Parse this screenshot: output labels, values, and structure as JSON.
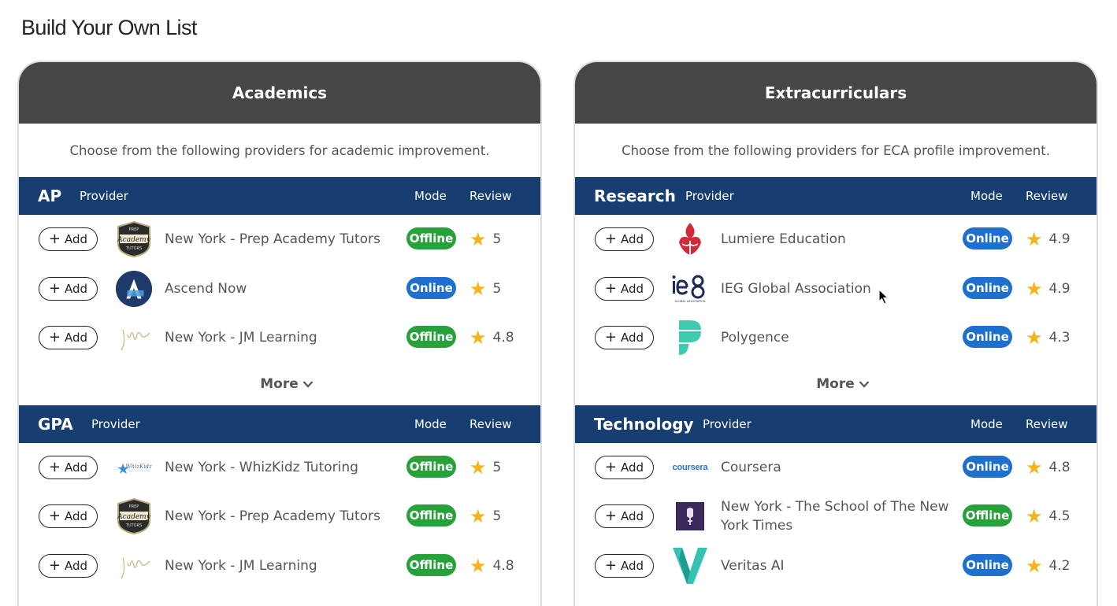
{
  "page_title": "Build Your Own List",
  "add_label": "Add",
  "more_label": "More",
  "colors": {
    "panel_header": "#464646",
    "category_header": "#163e70",
    "offline_badge": "#27a23b",
    "online_badge": "#1f6fcf",
    "star": "#f3b31a"
  },
  "academics": {
    "title": "Academics",
    "description": "Choose from the following providers for academic improvement.",
    "columns": {
      "provider": "Provider",
      "mode": "Mode",
      "review": "Review"
    },
    "categories": [
      {
        "name": "AP",
        "providers": [
          {
            "name": "New York - Prep Academy Tutors",
            "mode": "Offline",
            "rating": "5",
            "logo": "prep-academy-logo"
          },
          {
            "name": "Ascend Now",
            "mode": "Online",
            "rating": "5",
            "logo": "ascend-now-logo"
          },
          {
            "name": "New York - JM Learning",
            "mode": "Offline",
            "rating": "4.8",
            "logo": "jm-learning-logo"
          }
        ]
      },
      {
        "name": "GPA",
        "providers": [
          {
            "name": "New York - WhizKidz Tutoring",
            "mode": "Offline",
            "rating": "5",
            "logo": "whizkidz-logo"
          },
          {
            "name": "New York - Prep Academy Tutors",
            "mode": "Offline",
            "rating": "5",
            "logo": "prep-academy-logo"
          },
          {
            "name": "New York - JM Learning",
            "mode": "Offline",
            "rating": "4.8",
            "logo": "jm-learning-logo"
          }
        ]
      }
    ]
  },
  "extracurriculars": {
    "title": "Extracurriculars",
    "description": "Choose from the following providers for ECA profile improvement.",
    "columns": {
      "provider": "Provider",
      "mode": "Mode",
      "review": "Review"
    },
    "categories": [
      {
        "name": "Research",
        "providers": [
          {
            "name": "Lumiere Education",
            "mode": "Online",
            "rating": "4.9",
            "logo": "lumiere-logo"
          },
          {
            "name": "IEG Global Association",
            "mode": "Online",
            "rating": "4.9",
            "logo": "ieg-logo"
          },
          {
            "name": "Polygence",
            "mode": "Online",
            "rating": "4.3",
            "logo": "polygence-logo"
          }
        ]
      },
      {
        "name": "Technology",
        "providers": [
          {
            "name": "Coursera",
            "mode": "Online",
            "rating": "4.8",
            "logo": "coursera-logo",
            "logo_text": "coursera"
          },
          {
            "name": "New York - The School of The New York Times",
            "mode": "Offline",
            "rating": "4.5",
            "logo": "nyt-school-logo"
          },
          {
            "name": "Veritas AI",
            "mode": "Online",
            "rating": "4.2",
            "logo": "veritas-ai-logo"
          }
        ]
      }
    ]
  }
}
